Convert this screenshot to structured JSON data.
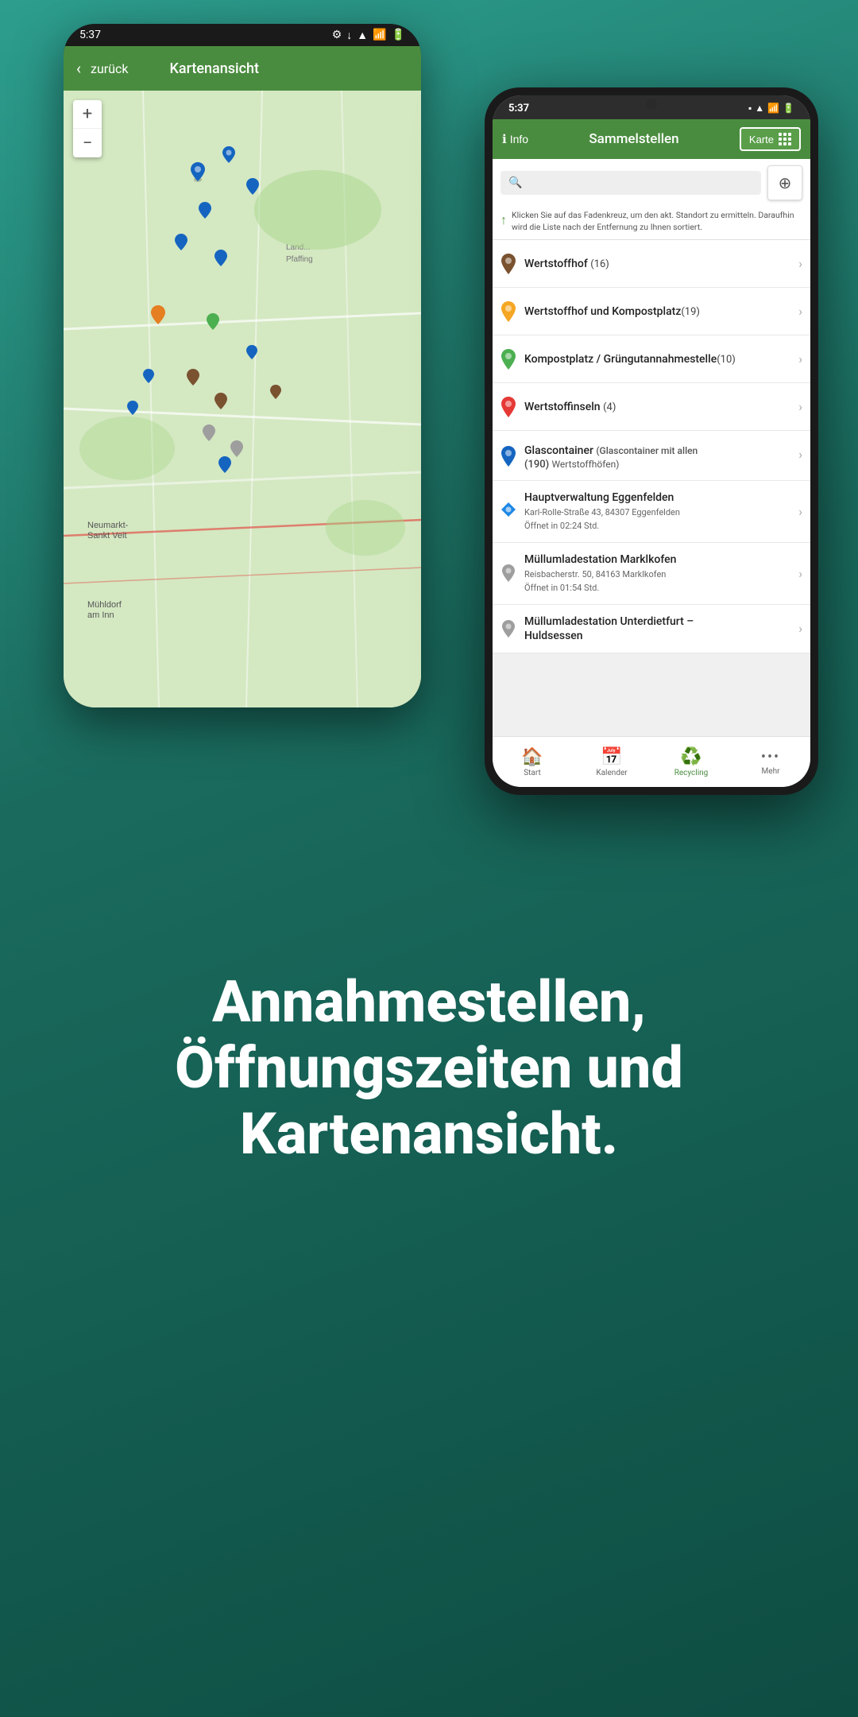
{
  "background": {
    "gradient_start": "#2d9e8e",
    "gradient_end": "#0e4d42"
  },
  "phone_back": {
    "status_time": "5:37",
    "app_bar": {
      "back_label": "zurück",
      "title": "Kartenansicht"
    }
  },
  "phone_front": {
    "status_time": "5:37",
    "header": {
      "info_label": "Info",
      "title": "Sammelstellen",
      "karte_label": "Karte"
    },
    "search": {
      "placeholder": "",
      "hint": "Klicken Sie auf das Fadenkreuz, um den akt. Standort zu ermitteln. Daraufhin wird die Liste nach der Entfernung zu Ihnen sortiert."
    },
    "list_items": [
      {
        "id": "wertstoffhof",
        "pin_color": "#7a5230",
        "title": "Wertstoffhof",
        "count": "(16)",
        "subtitle": "",
        "has_note": false
      },
      {
        "id": "wertstoffhof-kompost",
        "pin_color": "#f5a623",
        "title": "Wertstoffhof und Kompostplatz",
        "count": "(19)",
        "subtitle": "",
        "has_note": false
      },
      {
        "id": "kompostplatz",
        "pin_color": "#4caf50",
        "title": "Kompostplatz / Grüngutannahmestelle",
        "count": "(10)",
        "subtitle": "",
        "has_note": false
      },
      {
        "id": "wertstoffinseln",
        "pin_color": "#e53935",
        "title": "Wertstoffinseln",
        "count": "(4)",
        "subtitle": "",
        "has_note": false
      },
      {
        "id": "glascontainer",
        "pin_color": "#1565c0",
        "title": "Glascontainer",
        "count": "(190)",
        "note": "(Glascontainer mit allen Wertstoffhöfen)",
        "has_note": true
      },
      {
        "id": "hauptverwaltung",
        "pin_color": "#1e88e5",
        "pin_type": "diamond",
        "title": "Hauptverwaltung Eggenfelden",
        "subtitle": "Karl-Rolle-Straße 43, 84307 Eggenfelden",
        "opens": "Öffnet in 02:24 Std.",
        "has_note": false
      },
      {
        "id": "muellumladestation-marklkofen",
        "pin_color": "#9e9e9e",
        "pin_type": "round",
        "title": "Müllumladestation Marklkofen",
        "subtitle": "Reisbacherstr. 50, 84163 Marklkofen",
        "opens": "Öffnet in 01:54 Std.",
        "has_note": false
      },
      {
        "id": "muellumladestation-unterdietfurt",
        "pin_color": "#9e9e9e",
        "pin_type": "round",
        "title": "Müllumladestation Unterdietfurt –\nHuldsessen",
        "subtitle": "",
        "opens": "",
        "has_note": false
      }
    ],
    "bottom_nav": [
      {
        "id": "start",
        "icon": "🏠",
        "label": "Start",
        "active": false
      },
      {
        "id": "kalender",
        "icon": "📅",
        "label": "Kalender",
        "active": false
      },
      {
        "id": "recycling",
        "icon": "♻️",
        "label": "Recycling",
        "active": true
      },
      {
        "id": "mehr",
        "icon": "···",
        "label": "Mehr",
        "active": false
      }
    ]
  },
  "bottom_text": {
    "heading": "Annahmestellen, Öffnungszeiten und Kartenansicht."
  }
}
